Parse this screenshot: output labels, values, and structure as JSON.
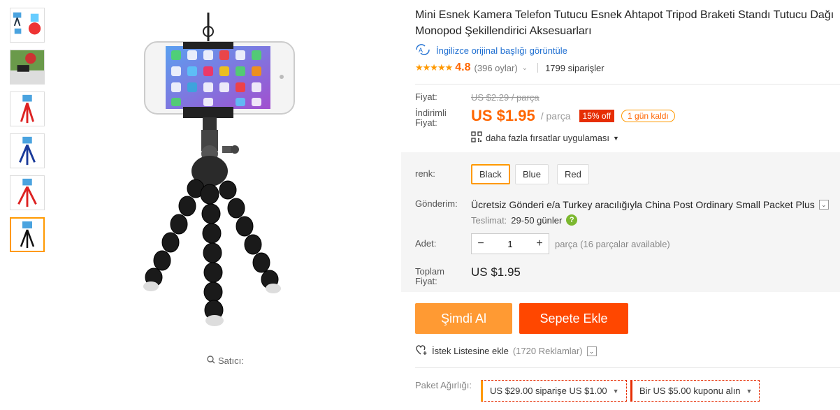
{
  "product": {
    "title": "Mini Esnek Kamera Telefon Tutucu Esnek Ahtapot Tripod Braketi Standı Tutucu Dağı Monopod Şekillendirici Aksesuarları",
    "translate_link": "İngilizce orijinal başlığı görüntüle",
    "stars": "★★★★★",
    "rating": "4.8",
    "votes": "(396 oylar)",
    "orders": "1799 siparişler"
  },
  "price": {
    "label": "Fiyat:",
    "old_price": "US $2.29 / parça",
    "discount_label_1": "İndirimli",
    "discount_label_2": "Fiyat:",
    "current": "US $1.95",
    "per": "/ parça",
    "discount_badge": "15% off",
    "days_left": "1 gün kaldı",
    "deals": "daha fazla fırsatlar uygulaması"
  },
  "color": {
    "label": "renk:",
    "options": [
      "Black",
      "Blue",
      "Red"
    ],
    "selected": "Black"
  },
  "shipping": {
    "label": "Gönderim:",
    "text": "Ücretsiz Gönderi e/a Turkey aracılığıyla China Post Ordinary Small Packet Plus",
    "eta_label": "Teslimat:",
    "eta_value": "29-50 günler"
  },
  "quantity": {
    "label": "Adet:",
    "value": "1",
    "note": "parça (16 parçalar available)"
  },
  "total": {
    "label_1": "Toplam",
    "label_2": "Fiyat:",
    "value": "US $1.95"
  },
  "actions": {
    "buy_now": "Şimdi Al",
    "add_to_cart": "Sepete Ekle",
    "wishlist": "İstek Listesine ekle",
    "wishlist_count": "(1720 Reklamlar)"
  },
  "package": {
    "label": "Paket Ağırlığı:",
    "coupon_1": "US $29.00 siparişe US $1.00",
    "coupon_2": "Bir US $5.00 kuponu alın"
  },
  "gallery": {
    "seller_label": "Satıcı:",
    "thumb_count": 6,
    "active_thumb": 6
  },
  "colors": {
    "accent_orange": "#ff9900",
    "price_orange": "#ff6600",
    "badge_red": "#e62e04",
    "buy_now_bg": "#ff9a33",
    "add_cart_bg": "#ff4700",
    "link_blue": "#1f6fd1"
  }
}
